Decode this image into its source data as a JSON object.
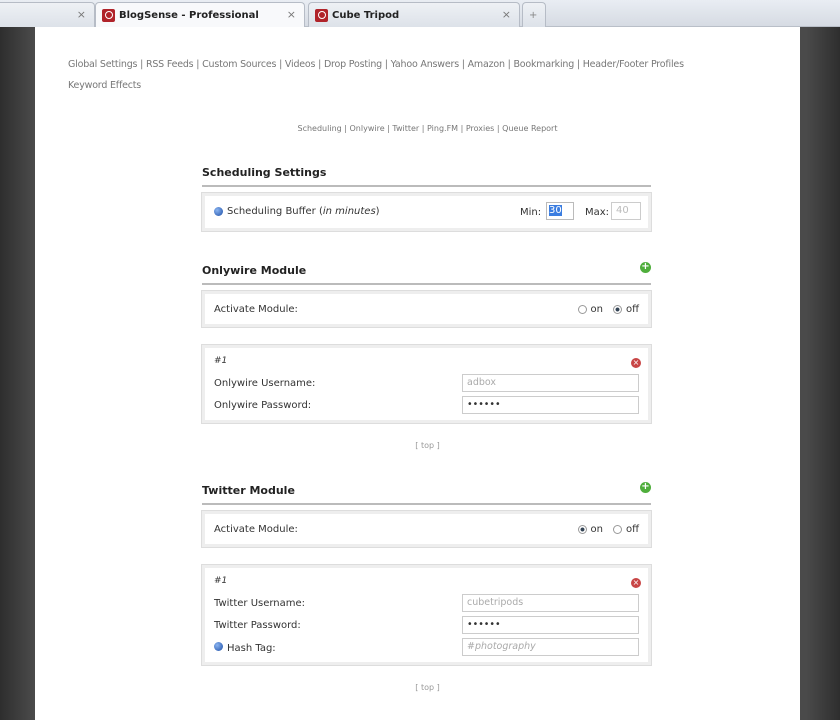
{
  "tabs": [
    {
      "label": ""
    },
    {
      "label": "BlogSense - Professional"
    },
    {
      "label": "Cube Tripod"
    }
  ],
  "nav": {
    "items": [
      "Global Settings",
      "RSS Feeds",
      "Custom Sources",
      "Videos",
      "Drop Posting",
      "Yahoo Answers",
      "Amazon",
      "Bookmarking",
      "Header/Footer Profiles",
      "Keyword Effects"
    ]
  },
  "subnav": {
    "items": [
      "Scheduling",
      "Onlywire",
      "Twitter",
      "Ping.FM",
      "Proxies",
      "Queue Report"
    ]
  },
  "scheduling": {
    "title": "Scheduling Settings",
    "label": "Scheduling Buffer (",
    "label_em": "in minutes",
    "label_end": ")",
    "min_label": "Min:",
    "min_value": "30",
    "max_label": "Max:",
    "max_value": "40"
  },
  "onlywire": {
    "title": "Onlywire Module",
    "activate_label": "Activate Module:",
    "on": "on",
    "off": "off",
    "selected": "off",
    "account_id": "#1",
    "username_label": "Onlywire Username:",
    "username": "adbox",
    "password_label": "Onlywire Password:",
    "password": "••••••",
    "top": "[ top ]"
  },
  "twitter": {
    "title": "Twitter Module",
    "activate_label": "Activate Module:",
    "on": "on",
    "off": "off",
    "selected": "on",
    "account_id": "#1",
    "username_label": "Twitter Username:",
    "username": "cubetripods",
    "password_label": "Twitter Password:",
    "password": "••••••",
    "hashtag_label": "Hash Tag:",
    "hashtag": "#photography",
    "top": "[ top ]"
  }
}
